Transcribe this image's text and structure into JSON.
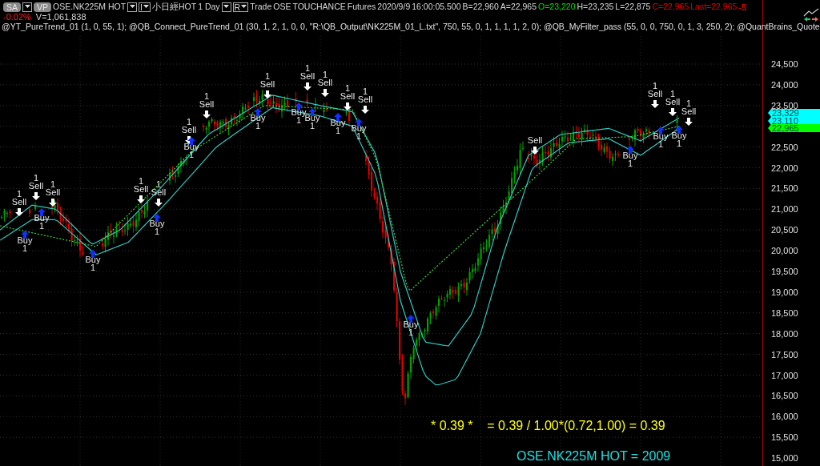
{
  "toolbar": [
    {
      "kind": "badge",
      "text": "SA"
    },
    {
      "kind": "dropdown"
    },
    {
      "kind": "badge",
      "text": "VP"
    },
    {
      "kind": "label",
      "text": "OSE.NK225M HOT"
    },
    {
      "kind": "dropdown"
    },
    {
      "kind": "box",
      "text": "I"
    },
    {
      "kind": "label",
      "text": "小日經HOT"
    },
    {
      "kind": "label",
      "text": "1 Day"
    },
    {
      "kind": "dropdown"
    },
    {
      "kind": "box",
      "text": "R"
    },
    {
      "kind": "label",
      "text": "Trade"
    },
    {
      "kind": "label",
      "text": "OSE"
    },
    {
      "kind": "label",
      "text": "TOUCHANCE"
    },
    {
      "kind": "label",
      "text": "Futures"
    },
    {
      "kind": "label",
      "text": "2020/9/9"
    },
    {
      "kind": "label",
      "text": "16:00:05.500"
    },
    {
      "kind": "label",
      "text": "B=22,960"
    },
    {
      "kind": "label",
      "text": "A=22,965"
    },
    {
      "kind": "label",
      "text": "O=23,220",
      "color": "#00e000"
    },
    {
      "kind": "label",
      "text": "H=23,235"
    },
    {
      "kind": "label",
      "text": "L=22,875"
    },
    {
      "kind": "label",
      "text": "C=22,965",
      "color": "#e00000"
    },
    {
      "kind": "label",
      "text": "Last=22,965",
      "color": "#e00000"
    },
    {
      "kind": "change",
      "text": "-5",
      "color": "#e00000"
    }
  ],
  "change": {
    "percent": "-0.02%",
    "volume": "V=1,061,838"
  },
  "indicators": "@YT_PureTrend_01 (1, 0, 55, 1); @QB_Connect_PureTrend_01 (30, 1, 2, 1, 0, 0, \"R:\\QB_Output\\NK225M_01_L.txt\", 750, 55, 0, 1, 1, 1, 1, 2, 0); @QB_MyFilter_pass (55, 0, 0, 750, 0, 1, 3, 250, 2); @QuantBrains_Quote",
  "price_axis": [
    "24,500",
    "24,000",
    "23,500",
    "22,500",
    "22,000",
    "21,500",
    "21,000",
    "20,500",
    "20,000",
    "19,500",
    "19,000",
    "18,500",
    "18,000",
    "17,500",
    "17,000",
    "16,500",
    "16,000",
    "15,500",
    "15,000"
  ],
  "price_markers": [
    {
      "text": "23,329",
      "color": "#00ffff"
    },
    {
      "text": "23,110",
      "color": "#00ffff"
    },
    {
      "text": "22,965",
      "color": "#00ff00"
    }
  ],
  "signals": [
    {
      "kind": "sell",
      "label": "Sell",
      "count": "1"
    },
    {
      "kind": "sell",
      "label": "Sell",
      "count": "1"
    },
    {
      "kind": "sell",
      "label": "Sell",
      "count": "1"
    },
    {
      "kind": "buy",
      "label": "Buy",
      "count": "1"
    },
    {
      "kind": "buy",
      "label": "Buy",
      "count": "1"
    },
    {
      "kind": "buy",
      "label": "Buy",
      "count": "1"
    },
    {
      "kind": "sell",
      "label": "Sell",
      "count": "1"
    },
    {
      "kind": "sell",
      "label": "Sell",
      "count": "1"
    },
    {
      "kind": "buy",
      "label": "Buy",
      "count": "1"
    },
    {
      "kind": "sell",
      "label": "Sell",
      "count": "1"
    },
    {
      "kind": "buy",
      "label": "Buy",
      "count": "1"
    },
    {
      "kind": "sell",
      "label": "Sell",
      "count": "1"
    },
    {
      "kind": "sell",
      "label": "Sell",
      "count": "1"
    },
    {
      "kind": "buy",
      "label": "Buy",
      "count": "1"
    },
    {
      "kind": "sell",
      "label": "Sell",
      "count": "1"
    },
    {
      "kind": "sell",
      "label": "Sell",
      "count": "1"
    },
    {
      "kind": "buy",
      "label": "Buy",
      "count": "1"
    },
    {
      "kind": "buy",
      "label": "Buy",
      "count": "1"
    },
    {
      "kind": "buy",
      "label": "Buy",
      "count": "1"
    },
    {
      "kind": "sell",
      "label": "Sell",
      "count": "1"
    },
    {
      "kind": "sell",
      "label": "Sell",
      "count": "1"
    },
    {
      "kind": "buy",
      "label": "Buy",
      "count": "1"
    },
    {
      "kind": "buy",
      "label": "Buy",
      "count": "1"
    },
    {
      "kind": "sell",
      "label": "Sell"
    },
    {
      "kind": "buy",
      "label": "Buy",
      "count": "1"
    },
    {
      "kind": "sell",
      "label": "Sell",
      "count": "1"
    },
    {
      "kind": "sell",
      "label": "Sell",
      "count": "1"
    },
    {
      "kind": "sell",
      "label": "Sell",
      "count": "1"
    },
    {
      "kind": "buy",
      "label": "Buy",
      "count": "1"
    },
    {
      "kind": "buy",
      "label": "Buy",
      "count": "1"
    }
  ],
  "formula": "* 0.39 *    = 0.39 / 1.00*(0.72,1.00) = 0.39",
  "result": "OSE.NK225M HOT = 2009"
}
